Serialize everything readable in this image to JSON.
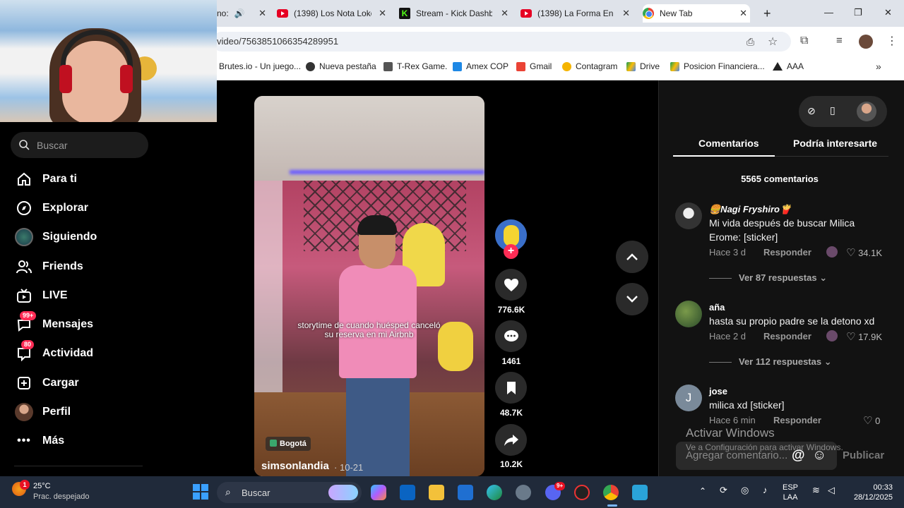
{
  "browser": {
    "tabs": [
      {
        "title": "no:",
        "icon": "speaker-icon"
      },
      {
        "title": "(1398) Los Nota Loko",
        "icon": "youtube-icon"
      },
      {
        "title": "Stream - Kick Dashbo",
        "icon": "kick-icon"
      },
      {
        "title": "(1398) La Forma En C",
        "icon": "youtube-icon"
      },
      {
        "title": "New Tab",
        "icon": "chrome-icon"
      }
    ],
    "new_tab": "+",
    "url": "video/7563851066354289951",
    "bookmarks": [
      "Brutes.io - Un juego...",
      "Nueva pestaña",
      "T-Rex Game.",
      "Amex COP",
      "Gmail",
      "Contagram",
      "Drive",
      "Posicion Financiera...",
      "AAA"
    ]
  },
  "sidebar": {
    "search_placeholder": "Buscar",
    "items": [
      {
        "label": "Para ti",
        "icon": "home-icon"
      },
      {
        "label": "Explorar",
        "icon": "compass-icon"
      },
      {
        "label": "Siguiendo",
        "icon": "following-avatar-icon"
      },
      {
        "label": "Friends",
        "icon": "friends-icon"
      },
      {
        "label": "LIVE",
        "icon": "live-tv-icon"
      },
      {
        "label": "Mensajes",
        "icon": "messages-icon",
        "badge": "99+"
      },
      {
        "label": "Actividad",
        "icon": "activity-icon",
        "badge": "80"
      },
      {
        "label": "Cargar",
        "icon": "upload-icon"
      },
      {
        "label": "Perfil",
        "icon": "profile-avatar-icon"
      },
      {
        "label": "Más",
        "icon": "more-dots-icon"
      }
    ]
  },
  "video": {
    "caption": "storytime de cuando huésped canceló su reserva en mi Airbnb",
    "location": "Bogotá",
    "author": "simsonlandia",
    "date": "10-21",
    "likes": "776.6K",
    "comments": "1461",
    "saves": "48.7K",
    "shares": "10.2K"
  },
  "panel": {
    "tab_comments": "Comentarios",
    "tab_interest": "Podría interesarte",
    "count": "5565 comentarios",
    "comments": [
      {
        "user": "🍔Nagi Fryshiro🍟",
        "text": "Mi vida después de buscar Milica Erome: [sticker]",
        "time": "Hace 3 d",
        "reply": "Responder",
        "likes": "34.1K",
        "more": "Ver 87 respuestas"
      },
      {
        "user": "aña",
        "text": "hasta su propio padre se la detono xd",
        "time": "Hace 2 d",
        "reply": "Responder",
        "likes": "17.9K",
        "more": "Ver 112 respuestas"
      },
      {
        "user": "jose",
        "text": "milica xd [sticker]",
        "time": "Hace 6 min",
        "reply": "Responder",
        "likes": "0",
        "avatar_letter": "J"
      }
    ],
    "add_placeholder": "Agregar comentario...",
    "publish": "Publicar",
    "watermark_title": "Activar Windows",
    "watermark_sub": "Ve a Configuración para activar Windows."
  },
  "taskbar": {
    "weather_temp": "25°C",
    "weather_desc": "Prac. despejado",
    "weather_badge": "1",
    "search_placeholder": "Buscar",
    "lang": "ESP",
    "lang2": "LAA",
    "time": "00:33",
    "date": "28/12/2025",
    "discord_badge": "9+"
  },
  "colors": {
    "accent": "#fe2c55",
    "panel_bg": "#121212",
    "taskbar_bg": "#202a3a"
  }
}
